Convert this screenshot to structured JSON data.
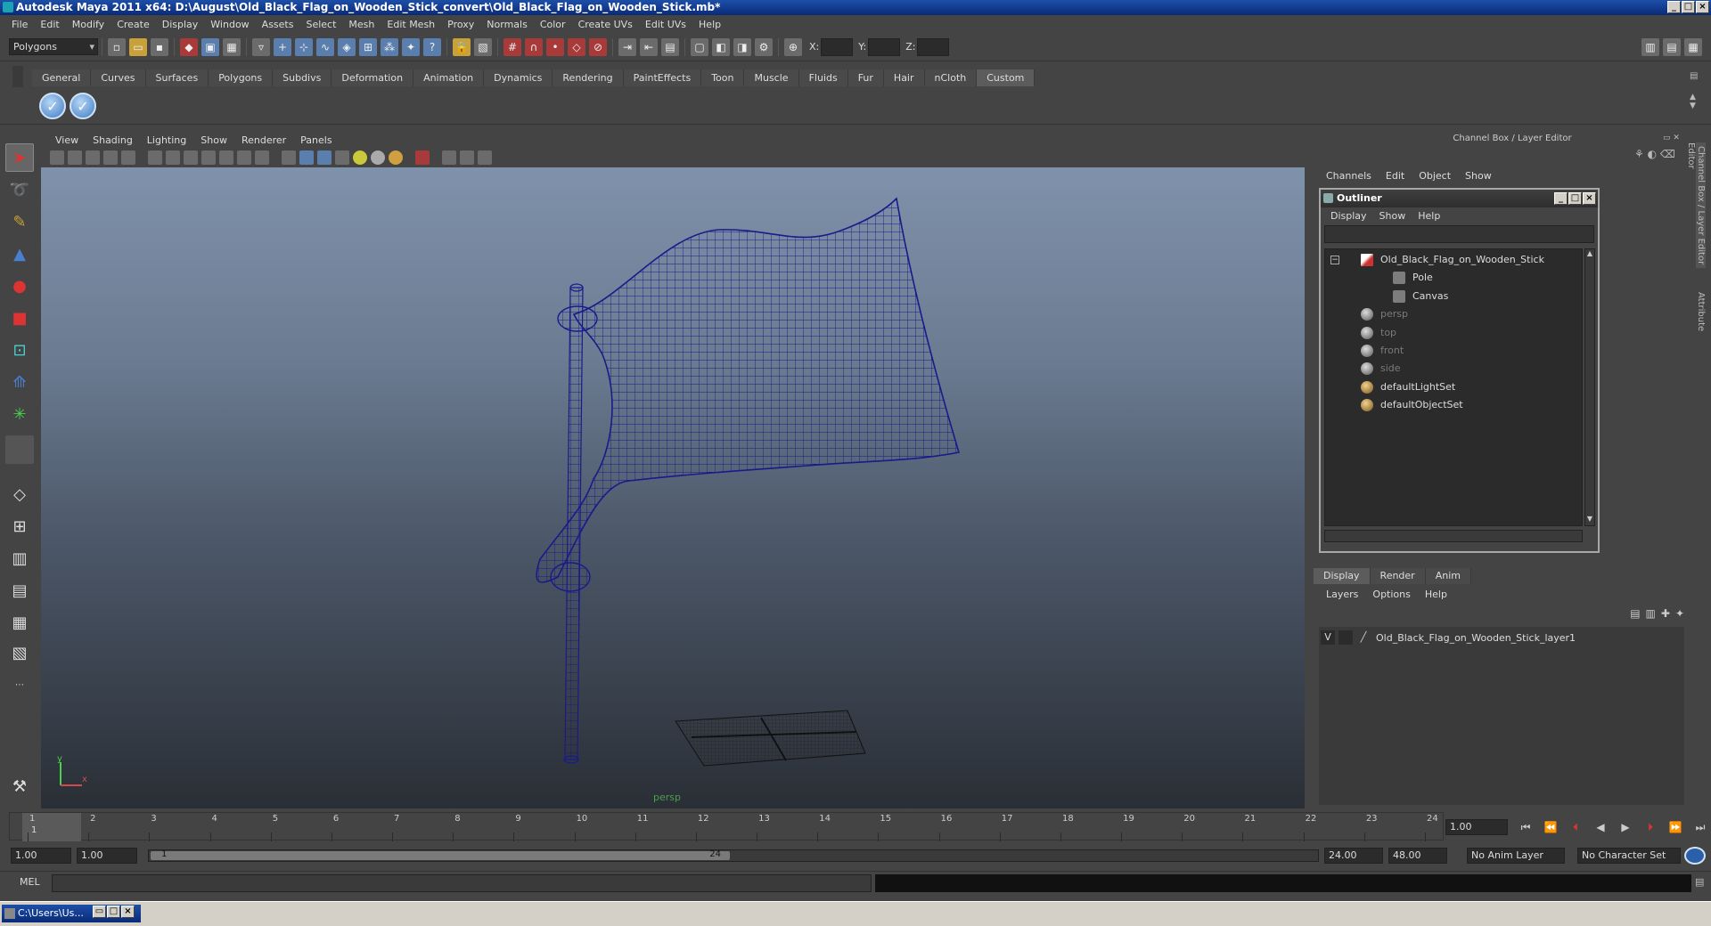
{
  "titlebar": {
    "title": "Autodesk Maya 2011 x64: D:\\August\\Old_Black_Flag_on_Wooden_Stick_convert\\Old_Black_Flag_on_Wooden_Stick.mb*"
  },
  "menubar": [
    "File",
    "Edit",
    "Modify",
    "Create",
    "Display",
    "Window",
    "Assets",
    "Select",
    "Mesh",
    "Edit Mesh",
    "Proxy",
    "Normals",
    "Color",
    "Create UVs",
    "Edit UVs",
    "Help"
  ],
  "statusline": {
    "mode": "Polygons",
    "x_label": "X:",
    "y_label": "Y:",
    "z_label": "Z:"
  },
  "shelf": {
    "tabs": [
      "General",
      "Curves",
      "Surfaces",
      "Polygons",
      "Subdivs",
      "Deformation",
      "Animation",
      "Dynamics",
      "Rendering",
      "PaintEffects",
      "Toon",
      "Muscle",
      "Fluids",
      "Fur",
      "Hair",
      "nCloth",
      "Custom"
    ],
    "active": "Custom"
  },
  "viewport": {
    "menu": [
      "View",
      "Shading",
      "Lighting",
      "Show",
      "Renderer",
      "Panels"
    ],
    "camera_label": "persp",
    "colors": {
      "wire": "#1a1a8a",
      "ground": "#222222"
    }
  },
  "channelbox": {
    "title": "Channel Box / Layer Editor",
    "menu": [
      "Channels",
      "Edit",
      "Object",
      "Show"
    ]
  },
  "outliner": {
    "title": "Outliner",
    "menu": [
      "Display",
      "Show",
      "Help"
    ],
    "items": [
      {
        "label": "Old_Black_Flag_on_Wooden_Stick",
        "icon": "transform-icon",
        "indent": 0,
        "color": "#dddddd"
      },
      {
        "label": "Pole",
        "icon": "mesh-icon",
        "indent": 1,
        "color": "#dddddd"
      },
      {
        "label": "Canvas",
        "icon": "mesh-icon",
        "indent": 1,
        "color": "#dddddd"
      },
      {
        "label": "persp",
        "icon": "camera-icon",
        "indent": 0,
        "color": "#7a7a7a"
      },
      {
        "label": "top",
        "icon": "camera-icon",
        "indent": 0,
        "color": "#7a7a7a"
      },
      {
        "label": "front",
        "icon": "camera-icon",
        "indent": 0,
        "color": "#7a7a7a"
      },
      {
        "label": "side",
        "icon": "camera-icon",
        "indent": 0,
        "color": "#7a7a7a"
      },
      {
        "label": "defaultLightSet",
        "icon": "set-icon",
        "indent": 0,
        "color": "#dddddd"
      },
      {
        "label": "defaultObjectSet",
        "icon": "set-icon",
        "indent": 0,
        "color": "#dddddd"
      }
    ]
  },
  "layers": {
    "tabs": [
      "Display",
      "Render",
      "Anim"
    ],
    "active": "Display",
    "menu": [
      "Layers",
      "Options",
      "Help"
    ],
    "rows": [
      {
        "visible": "V",
        "name": "Old_Black_Flag_on_Wooden_Stick_layer1"
      }
    ]
  },
  "side_tabs": [
    "Channel Box / Layer Editor",
    "Attribute Editor"
  ],
  "timeline": {
    "ticks": [
      "1",
      "2",
      "3",
      "4",
      "5",
      "6",
      "7",
      "8",
      "9",
      "10",
      "11",
      "12",
      "13",
      "14",
      "15",
      "16",
      "17",
      "18",
      "19",
      "20",
      "21",
      "22",
      "23",
      "24"
    ],
    "current_frame": "1.00",
    "playhead": "1"
  },
  "range": {
    "start": "1.00",
    "playback_start": "1.00",
    "slider_start": "1",
    "slider_end": "24",
    "playback_end": "24.00",
    "end": "48.00",
    "anim_layer": "No Anim Layer",
    "character_set": "No Character Set"
  },
  "cmdline": {
    "label": "MEL"
  },
  "taskbar": {
    "item": "C:\\Users\\Us..."
  }
}
